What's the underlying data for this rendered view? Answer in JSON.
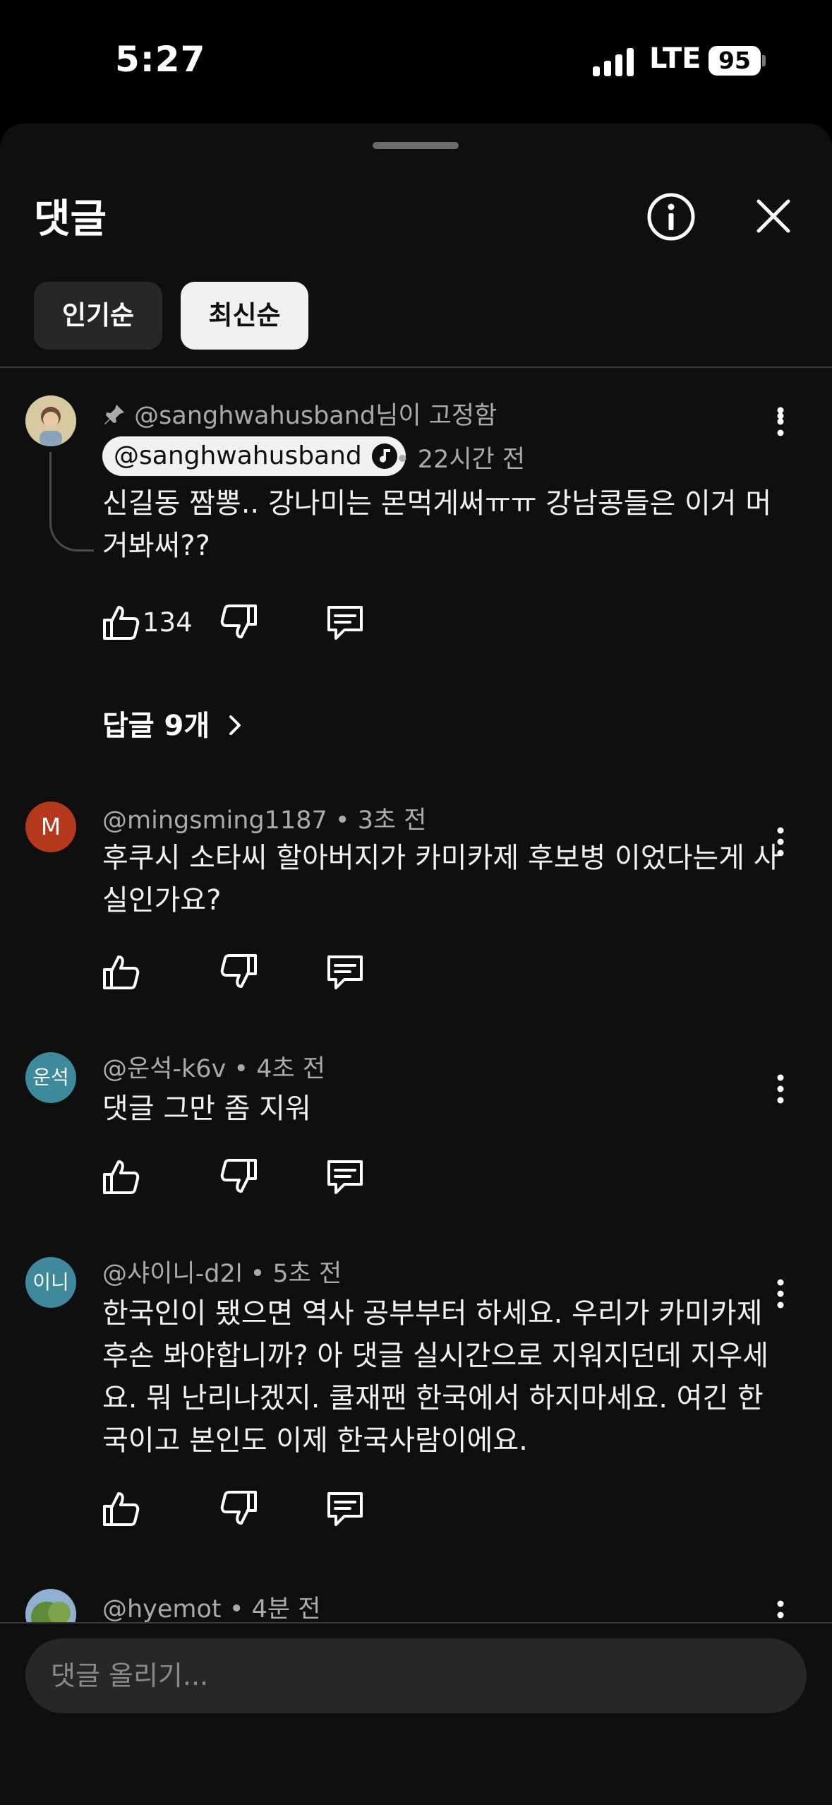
{
  "status_bar": {
    "time": "5:27",
    "network": "LTE",
    "battery": "95"
  },
  "sheet": {
    "title": "댓글"
  },
  "sort_chips": {
    "popular": "인기순",
    "newest": "최신순",
    "selected": "newest"
  },
  "comments": [
    {
      "pinned_text": "@sanghwahusband님이 고정함",
      "author": "@sanghwahusband",
      "time": "22시간 전",
      "text": "신길동 짬뽕.. 강나미는 몬먹게써ㅠㅠ 강남콩들은 이거 머거봐써??",
      "likes": "134",
      "replies": "답글 9개"
    },
    {
      "avatar": "M",
      "avatar_color": "#b5381c",
      "author": "@mingsming1187",
      "time": "3초 전",
      "text": "후쿠시 소타씨 할아버지가 카미카제 후보병 이었다는게 사실인가요?"
    },
    {
      "avatar": "운석",
      "avatar_color": "#3d8a9c",
      "author": "@운석-k6v",
      "time": "4초 전",
      "text": "댓글 그만 좀 지워"
    },
    {
      "avatar": "이니",
      "avatar_color": "#3d8a9c",
      "author": "@샤이니-d2l",
      "time": "5초 전",
      "text": "한국인이 됐으면 역사 공부부터 하세요. 우리가 카미카제 후손 봐야합니까? 아 댓글 실시간으로 지워지던데 지우세요. 뭐 난리나겠지. 쿨재팬 한국에서 하지마세요. 여긴 한국이고 본인도 이제 한국사람이에요."
    },
    {
      "author": "@hyemot",
      "time": "4분 전"
    }
  ],
  "composer": {
    "placeholder": "댓글 올리기..."
  },
  "dot": "•"
}
